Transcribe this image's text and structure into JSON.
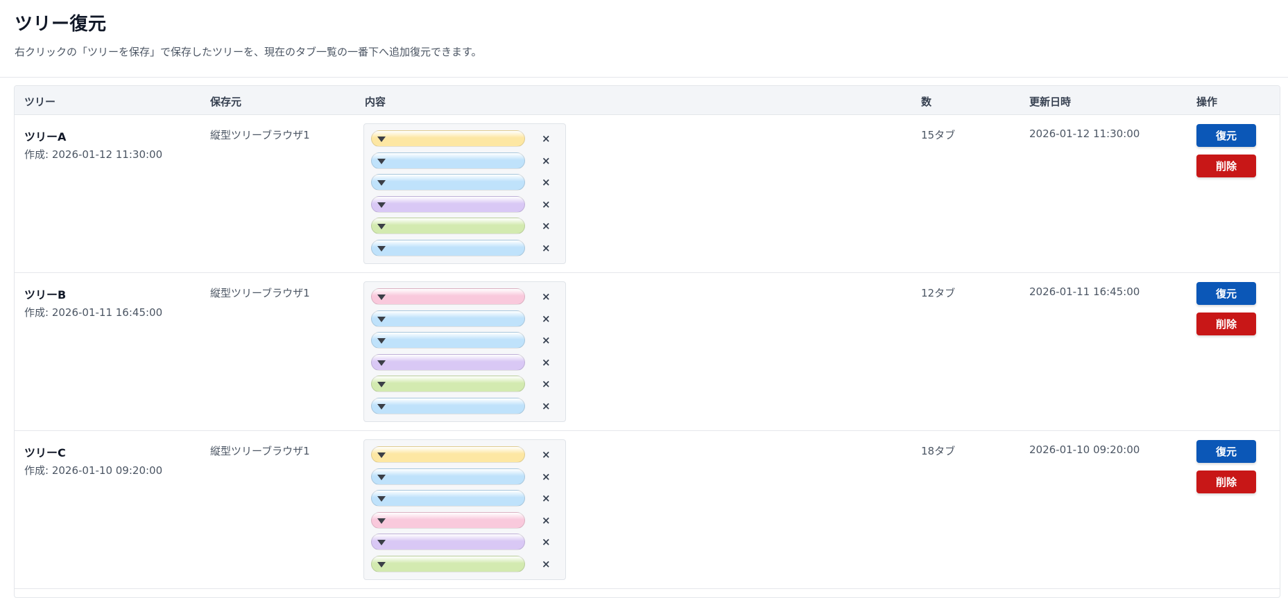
{
  "page": {
    "title": "ツリー復元",
    "description": "右クリックの「ツリーを保存」で保存したツリーを、現在のタブ一覧の一番下へ追加復元できます。"
  },
  "table": {
    "headers": {
      "tree": "ツリー",
      "source": "保存元",
      "content": "内容",
      "count": "数",
      "updated": "更新日時",
      "actions": "操作"
    },
    "remove_glyph": "×",
    "rows": [
      {
        "name": "ツリーA",
        "created": "作成: 2026-01-12 11:30:00",
        "source": "縦型ツリーブラウザ1",
        "count": "15タブ",
        "updated": "2026-01-12 11:30:00",
        "restore_label": "復元",
        "delete_label": "削除",
        "tab_colors": [
          "#fde7a3",
          "#bfe2fb",
          "#bfe2fb",
          "#d9c8f5",
          "#d3eab0",
          "#bfe2fb"
        ]
      },
      {
        "name": "ツリーB",
        "created": "作成: 2026-01-11 16:45:00",
        "source": "縦型ツリーブラウザ1",
        "count": "12タブ",
        "updated": "2026-01-11 16:45:00",
        "restore_label": "復元",
        "delete_label": "削除",
        "tab_colors": [
          "#f9c9dc",
          "#bfe2fb",
          "#bfe2fb",
          "#d9c8f5",
          "#d3eab0",
          "#bfe2fb"
        ]
      },
      {
        "name": "ツリーC",
        "created": "作成: 2026-01-10 09:20:00",
        "source": "縦型ツリーブラウザ1",
        "count": "18タブ",
        "updated": "2026-01-10 09:20:00",
        "restore_label": "復元",
        "delete_label": "削除",
        "tab_colors": [
          "#fde7a3",
          "#bfe2fb",
          "#bfe2fb",
          "#f9c9dc",
          "#d9c8f5",
          "#d3eab0"
        ]
      }
    ]
  },
  "colors": {
    "restore_button": "#0b57b7",
    "delete_button": "#c81717",
    "header_bg": "#f3f5f8"
  }
}
